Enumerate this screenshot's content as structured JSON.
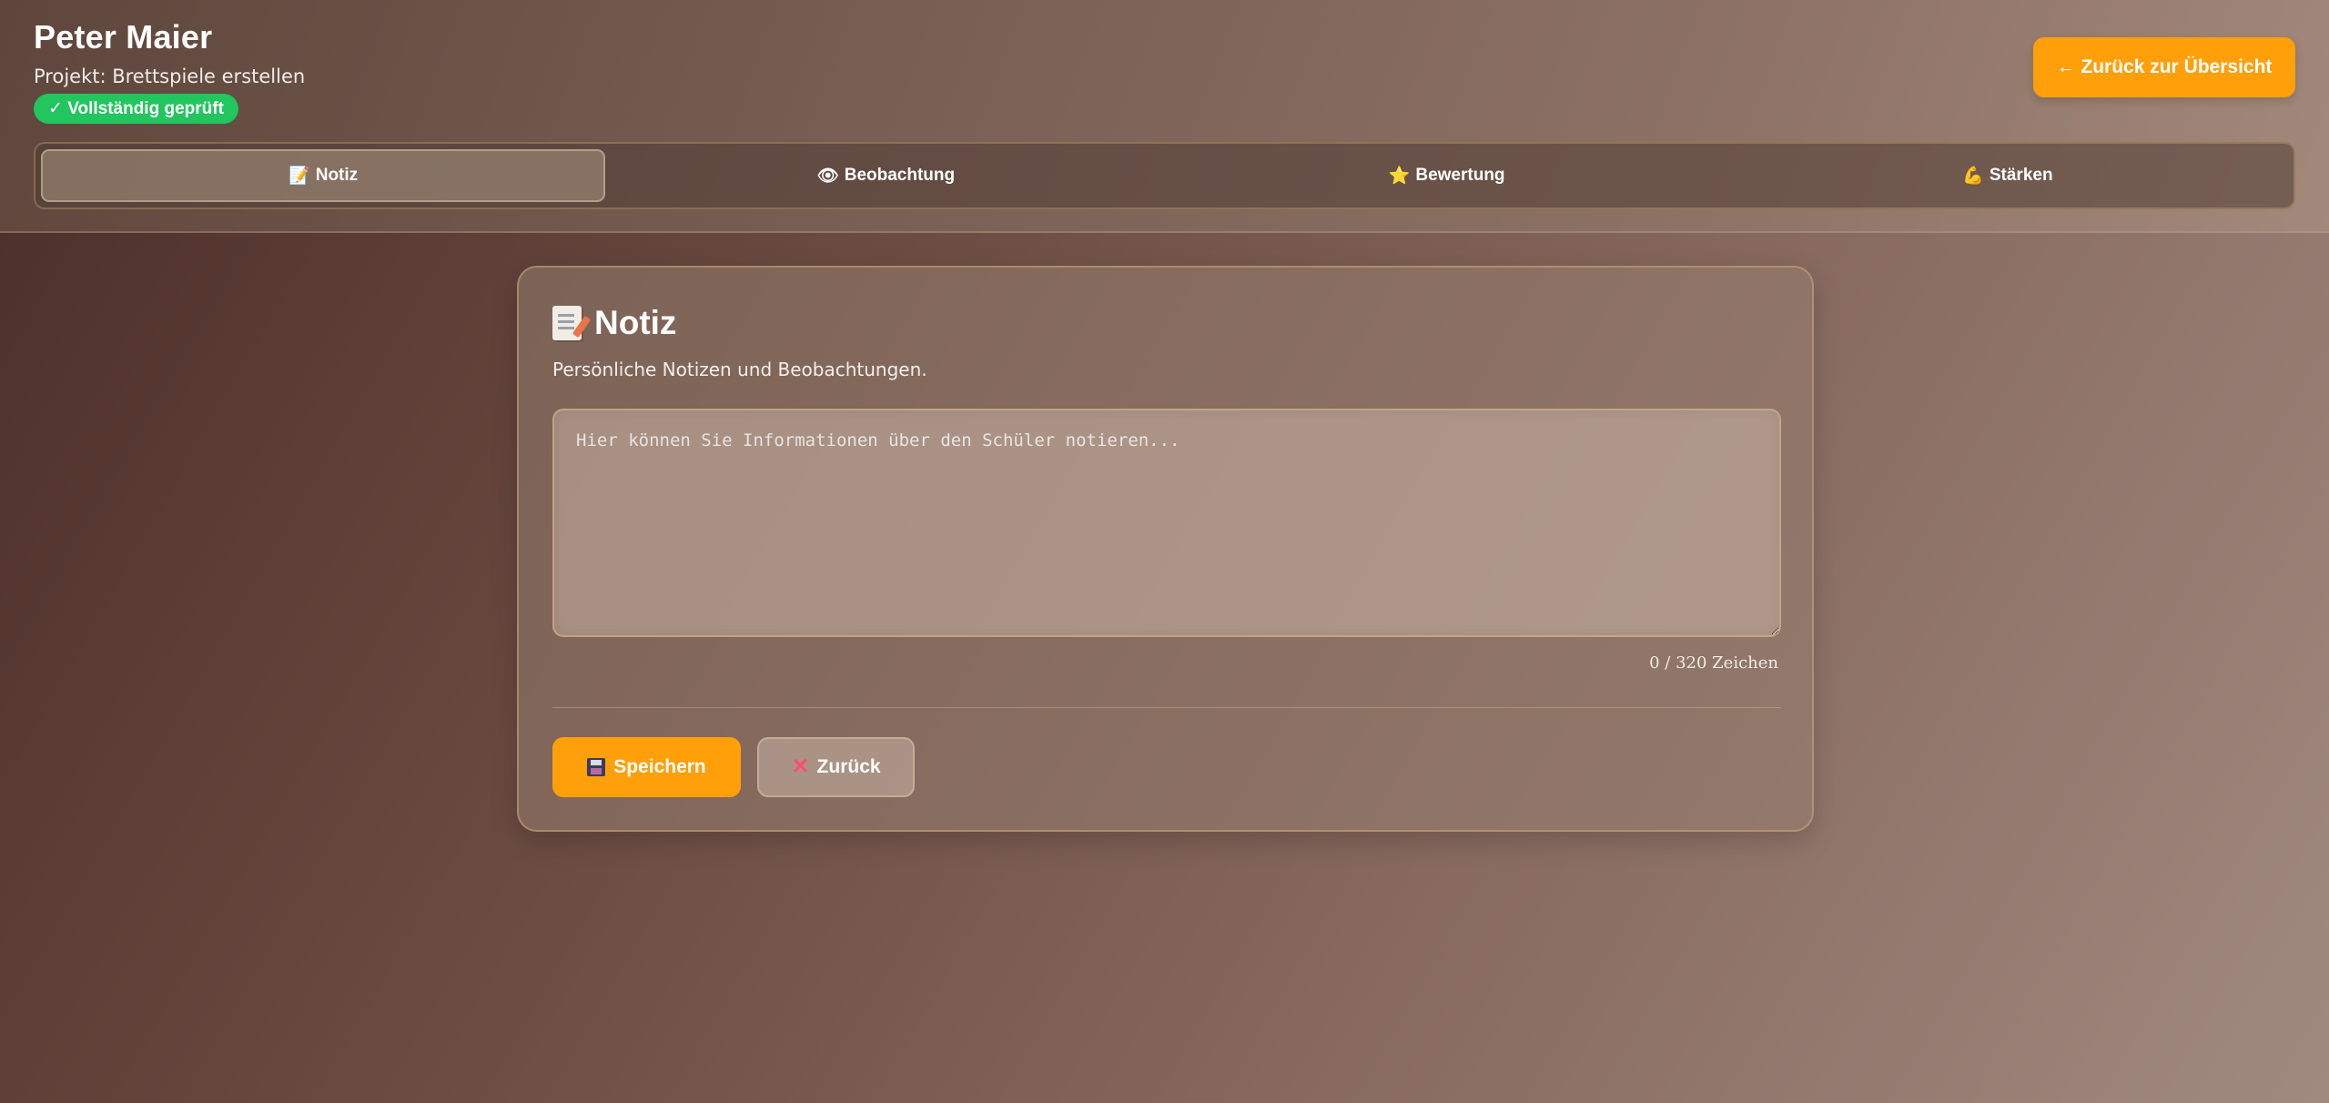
{
  "header": {
    "student_name": "Peter Maier",
    "project_line": "Projekt: Brettspiele erstellen",
    "status_badge": "✓ Vollständig geprüft",
    "back_overview_label": "← Zurück zur Übersicht"
  },
  "tabs": [
    {
      "icon": "📝",
      "label": "Notiz",
      "active": true
    },
    {
      "icon": "👁",
      "label": "Beobachtung",
      "active": false
    },
    {
      "icon": "⭐",
      "label": "Bewertung",
      "active": false
    },
    {
      "icon": "💪",
      "label": "Stärken",
      "active": false
    }
  ],
  "card": {
    "title": "Notiz",
    "subtitle": "Persönliche Notizen und Beobachtungen.",
    "textarea_value": "",
    "textarea_placeholder": "Hier können Sie Informationen über den Schüler notieren...",
    "char_counter": "0 / 320 Zeichen",
    "save_label": "Speichern",
    "back_label": "Zurück"
  },
  "colors": {
    "accent": "#ff9f0a",
    "success": "#22c55e"
  }
}
